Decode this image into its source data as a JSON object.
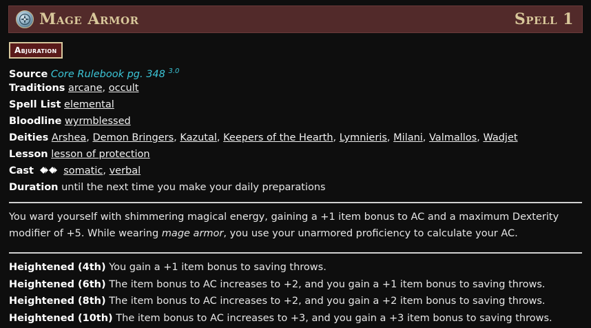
{
  "title_bar": {
    "name": "Mage Armor",
    "rank": "Spell 1",
    "tradition_icon": "arcane-tradition-icon"
  },
  "trait": "Abjuration",
  "meta": {
    "source_label": "Source",
    "source_book": "Core Rulebook pg. 348",
    "source_version": "3.0",
    "traditions_label": "Traditions",
    "traditions": [
      "arcane",
      "occult"
    ],
    "spell_list_label": "Spell List",
    "spell_list": "elemental",
    "bloodline_label": "Bloodline",
    "bloodline": "wyrmblessed",
    "deities_label": "Deities",
    "deities": [
      "Arshea",
      "Demon Bringers",
      "Kazutal",
      "Keepers of the Hearth",
      "Lymnieris",
      "Milani",
      "Valmallos",
      "Wadjet"
    ],
    "lesson_label": "Lesson",
    "lesson": "lesson of protection",
    "cast_label": "Cast",
    "cast_icon": "two-actions-icon",
    "cast_components": [
      "somatic",
      "verbal"
    ],
    "duration_label": "Duration",
    "duration": "until the next time you make your daily preparations"
  },
  "description": {
    "line1": "You ward yourself with shimmering magical energy, gaining a +1 item bonus to AC and a maximum Dexterity",
    "line2_before": "modifier of +5. While wearing ",
    "line2_italic": "mage armor",
    "line2_after": ", you use your unarmored proficiency to calculate your AC."
  },
  "heightened": [
    {
      "label": "Heightened (4th)",
      "text": "You gain a +1 item bonus to saving throws."
    },
    {
      "label": "Heightened (6th)",
      "text": "The item bonus to AC increases to +2, and you gain a +1 item bonus to saving throws."
    },
    {
      "label": "Heightened (8th)",
      "text": "The item bonus to AC increases to +2, and you gain a +2 item bonus to saving throws."
    },
    {
      "label": "Heightened (10th)",
      "text": "The item bonus to AC increases to +3, and you gain a +3 item bonus to saving throws."
    }
  ],
  "colors": {
    "title_bar_bg": "#522a2a",
    "title_text": "#d8c79a",
    "trait_bg": "#5a1a1a",
    "trait_border": "#d8c89e",
    "book_link": "#3cc6d8",
    "page_bg": "#0e0e0e"
  }
}
